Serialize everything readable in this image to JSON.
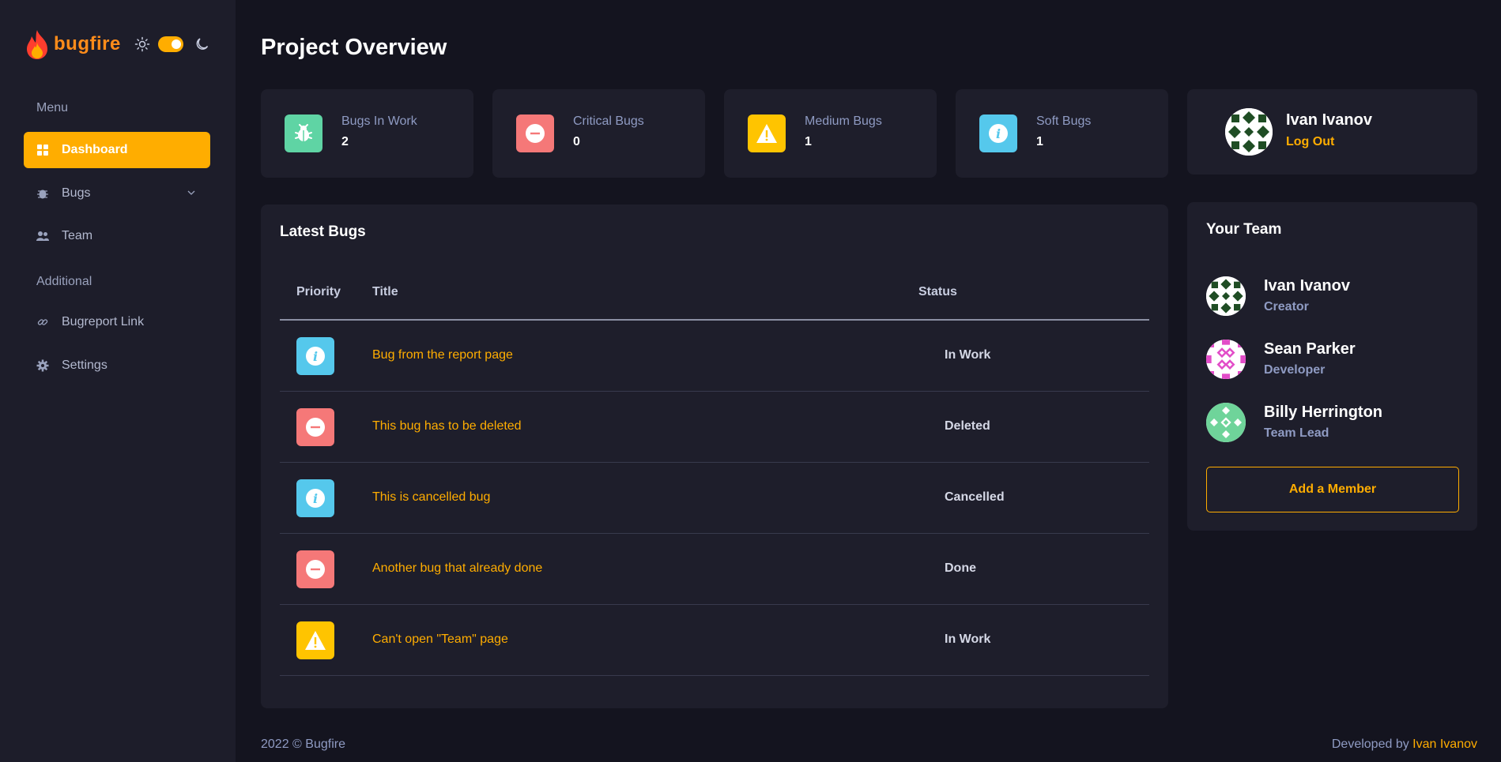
{
  "brand": {
    "name": "bugfire"
  },
  "sidebar": {
    "menu_heading": "Menu",
    "items": [
      {
        "label": "Dashboard",
        "icon": "grid-icon",
        "active": true
      },
      {
        "label": "Bugs",
        "icon": "bug-icon",
        "has_submenu": true
      },
      {
        "label": "Team",
        "icon": "users-icon"
      }
    ],
    "additional_heading": "Additional",
    "additional_items": [
      {
        "label": "Bugreport Link",
        "icon": "link-icon"
      },
      {
        "label": "Settings",
        "icon": "gear-icon"
      }
    ]
  },
  "page": {
    "title": "Project Overview"
  },
  "stats": [
    {
      "label": "Bugs In Work",
      "value": "2",
      "icon": "bug-icon",
      "color": "#5fd4a4"
    },
    {
      "label": "Critical Bugs",
      "value": "0",
      "icon": "minus-circle-icon",
      "color": "#f57878"
    },
    {
      "label": "Medium Bugs",
      "value": "1",
      "icon": "warning-icon",
      "color": "#ffc400"
    },
    {
      "label": "Soft Bugs",
      "value": "1",
      "icon": "info-icon",
      "color": "#55c8ec"
    }
  ],
  "profile": {
    "name": "Ivan Ivanov",
    "logout": "Log Out"
  },
  "latest_bugs": {
    "title": "Latest Bugs",
    "columns": [
      "Priority",
      "Title",
      "Status"
    ],
    "rows": [
      {
        "priority": "soft",
        "title": "Bug from the report page",
        "status": "In Work"
      },
      {
        "priority": "critical",
        "title": "This bug has to be deleted",
        "status": "Deleted"
      },
      {
        "priority": "soft",
        "title": "This is cancelled bug",
        "status": "Cancelled"
      },
      {
        "priority": "critical",
        "title": "Another bug that already done",
        "status": "Done"
      },
      {
        "priority": "medium",
        "title": "Can't open \"Team\" page",
        "status": "In Work"
      }
    ]
  },
  "team": {
    "title": "Your Team",
    "members": [
      {
        "name": "Ivan Ivanov",
        "role": "Creator",
        "avatar_color": "#1f4d24"
      },
      {
        "name": "Sean Parker",
        "role": "Developer",
        "avatar_color": "#e24cc8"
      },
      {
        "name": "Billy Herrington",
        "role": "Team Lead",
        "avatar_color": "#6fd49a"
      }
    ],
    "add_button": "Add a Member"
  },
  "footer": {
    "copyright": "2022 © Bugfire",
    "developed_prefix": "Developed by",
    "developer": "Ivan Ivanov"
  },
  "colors": {
    "accent": "#ffad00",
    "background": "#14141f",
    "card": "#1e1e2b",
    "sidebar": "#1d1d2a"
  }
}
